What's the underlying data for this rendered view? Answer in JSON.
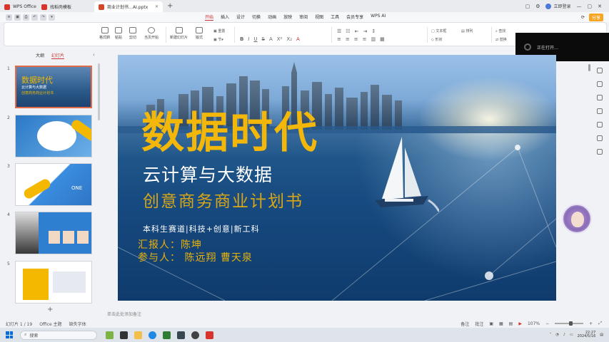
{
  "titlebar": {
    "tabs": [
      {
        "label": "WPS Office",
        "color": "#d9342b"
      },
      {
        "label": "找稻壳模板",
        "color": "#d9342b"
      },
      {
        "label": "商业计划书…AI.pptx",
        "color": "#d24726"
      }
    ],
    "user": "立即登录"
  },
  "menubar": {
    "tabs": [
      "开始",
      "插入",
      "设计",
      "切换",
      "动画",
      "放映",
      "审阅",
      "视图",
      "工具",
      "会员专享",
      "WPS AI"
    ],
    "selected": "开始",
    "share": "分享"
  },
  "ribbon": {
    "paste": "格式刷",
    "clipboard": "粘贴",
    "cut": "剪切",
    "current_page": "当页开始",
    "new_slide": "新建幻灯片",
    "layout": "版式",
    "textbox": "文本框",
    "shape": "形状",
    "arrange": "排列",
    "find": "查找",
    "replace": "替换"
  },
  "popup": {
    "text": "正在打开…"
  },
  "leftpanel": {
    "tabs": [
      "大纲",
      "幻灯片"
    ],
    "selected": "幻灯片",
    "slides": [
      {
        "num": "1",
        "title": "数据时代",
        "sub": "云计算与大数据",
        "sub2": "创意商务商业计划书"
      },
      {
        "num": "2"
      },
      {
        "num": "3",
        "label": "ONE"
      },
      {
        "num": "4"
      },
      {
        "num": "5"
      }
    ]
  },
  "slide": {
    "title": "数据时代",
    "subtitle": "云计算与大数据",
    "subtitle2": "创意商务商业计划书",
    "track": "本科生赛道|科技+创意|新工科",
    "reporter": "汇报人：陈坤",
    "participants": "参与人：  陈远翔  曹天泉"
  },
  "notes": "单击此处添加备注",
  "statusbar": {
    "slide_info": "幻灯片 1 / 19",
    "theme": "Office 主题",
    "font": "缺失字体",
    "notes_btn": "备注",
    "comment_btn": "批注",
    "zoom": "107%"
  },
  "taskbar": {
    "search_placeholder": "搜索",
    "time": "22:27",
    "date": "2024/5/16"
  }
}
